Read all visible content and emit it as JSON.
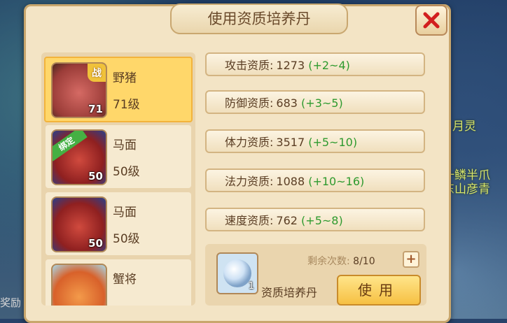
{
  "dialog": {
    "title": "使用资质培养丹"
  },
  "background": {
    "side_texts": [
      "月灵",
      "一鳞半爪",
      "东山彦青"
    ],
    "bottom_left_text": "奖励"
  },
  "pets": [
    {
      "name": "野猪",
      "level": "71级",
      "level_num": "71",
      "badge": "战",
      "selected": true
    },
    {
      "name": "马面",
      "level": "50级",
      "level_num": "50",
      "badge": "绑定",
      "selected": false
    },
    {
      "name": "马面",
      "level": "50级",
      "level_num": "50",
      "badge": "",
      "selected": false
    },
    {
      "name": "蟹将",
      "level": "",
      "level_num": "",
      "badge": "",
      "selected": false
    }
  ],
  "stats": [
    {
      "label": "攻击资质:",
      "value": "1273",
      "bonus": "(+2~4)"
    },
    {
      "label": "防御资质:",
      "value": "683",
      "bonus": "(+3~5)"
    },
    {
      "label": "体力资质:",
      "value": "3517",
      "bonus": "(+5~10)"
    },
    {
      "label": "法力资质:",
      "value": "1088",
      "bonus": "(+10~16)"
    },
    {
      "label": "速度资质:",
      "value": "762",
      "bonus": "(+5~8)"
    }
  ],
  "item": {
    "name": "资质培养丹",
    "count": "1",
    "remaining_label": "剩余次数:",
    "remaining_value": "8/10",
    "plus_label": "+",
    "use_label": "使用"
  },
  "colors": {
    "bonus": "#2e9a2e",
    "selected": "#ffd76a",
    "panel": "#f3e4c5"
  }
}
